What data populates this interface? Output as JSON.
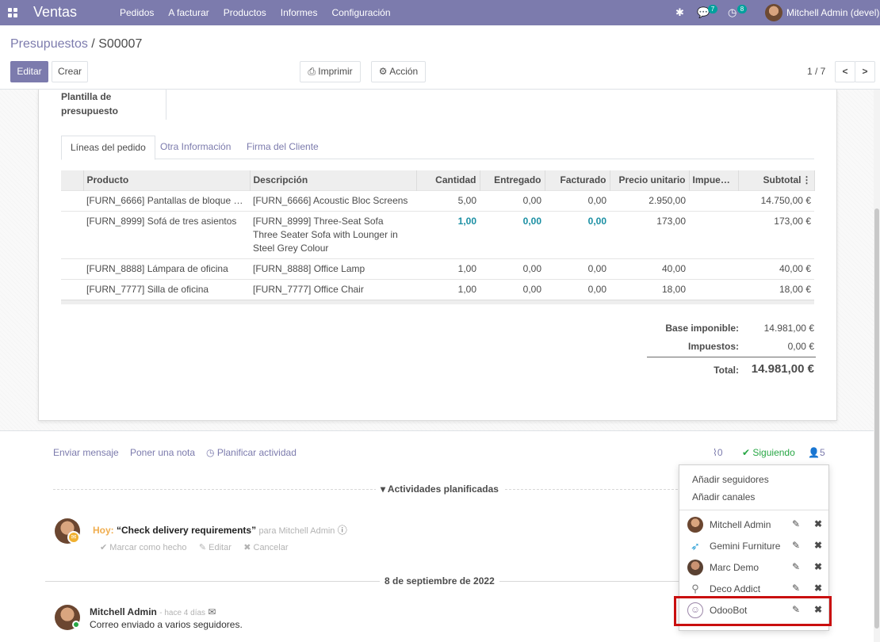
{
  "navbar": {
    "app_name": "Ventas",
    "menu": [
      "Pedidos",
      "A facturar",
      "Productos",
      "Informes",
      "Configuración"
    ],
    "messages_count": "7",
    "activities_count": "8",
    "user_name": "Mitchell Admin (devel)"
  },
  "breadcrumb": {
    "parent": "Presupuestos",
    "separator": " / ",
    "current": "S00007"
  },
  "buttons": {
    "edit": "Editar",
    "create": "Crear",
    "print": "Imprimir",
    "action": "Acción"
  },
  "pager": {
    "value": "1 / 7"
  },
  "form": {
    "template_label": "Plantilla de presupuesto",
    "tabs": [
      "Líneas del pedido",
      "Otra Información",
      "Firma del Cliente"
    ],
    "columns": [
      "Producto",
      "Descripción",
      "Cantidad",
      "Entregado",
      "Facturado",
      "Precio unitario",
      "Impuest…",
      "Subtotal"
    ],
    "lines": [
      {
        "product": "[FURN_6666] Pantallas de bloque ac…",
        "description": "[FURN_6666] Acoustic Bloc Screens",
        "qty": "5,00",
        "delivered": "0,00",
        "invoiced": "0,00",
        "price": "2.950,00",
        "taxes": "",
        "subtotal": "14.750,00 €"
      },
      {
        "product": "[FURN_8999] Sofá de tres asientos",
        "description": "[FURN_8999] Three-Seat Sofa Three Seater Sofa with Lounger in Steel Grey Colour",
        "qty": "1,00",
        "delivered": "0,00",
        "invoiced": "0,00",
        "price": "173,00",
        "taxes": "",
        "subtotal": "173,00 €"
      },
      {
        "product": "[FURN_8888] Lámpara de oficina",
        "description": "[FURN_8888] Office Lamp",
        "qty": "1,00",
        "delivered": "0,00",
        "invoiced": "0,00",
        "price": "40,00",
        "taxes": "",
        "subtotal": "40,00 €"
      },
      {
        "product": "[FURN_7777] Silla de oficina",
        "description": "[FURN_7777] Office Chair",
        "qty": "1,00",
        "delivered": "0,00",
        "invoiced": "0,00",
        "price": "18,00",
        "taxes": "",
        "subtotal": "18,00 €"
      }
    ],
    "totals": {
      "base_label": "Base imponible:",
      "base_value": "14.981,00 €",
      "tax_label": "Impuestos:",
      "tax_value": "0,00 €",
      "total_label": "Total:",
      "total_value": "14.981,00 €"
    }
  },
  "chatter": {
    "send_message": "Enviar mensaje",
    "log_note": "Poner una nota",
    "schedule": "Planificar actividad",
    "attachments": "0",
    "following": "Siguiendo",
    "followers_count": "5",
    "activities_title": "Actividades planificadas",
    "activity": {
      "when": "Hoy:",
      "summary": "“Check delivery requirements”",
      "for": "para Mitchell Admin",
      "mark_done": "Marcar como hecho",
      "edit": "Editar",
      "cancel": "Cancelar"
    },
    "date_separator": "8 de septiembre de 2022",
    "message": {
      "author": "Mitchell Admin",
      "time": "- hace 4 días",
      "body": "Correo enviado a varios seguidores."
    }
  },
  "followers_dropdown": {
    "add_followers": "Añadir seguidores",
    "add_channels": "Añadir canales",
    "followers": [
      "Mitchell Admin",
      "Gemini Furniture",
      "Marc Demo",
      "Deco Addict",
      "OdooBot"
    ]
  },
  "colors": {
    "brand": "#7c7bad",
    "highlight": "#c90f0f",
    "teal": "#1a8fa3",
    "following": "#28a745"
  }
}
